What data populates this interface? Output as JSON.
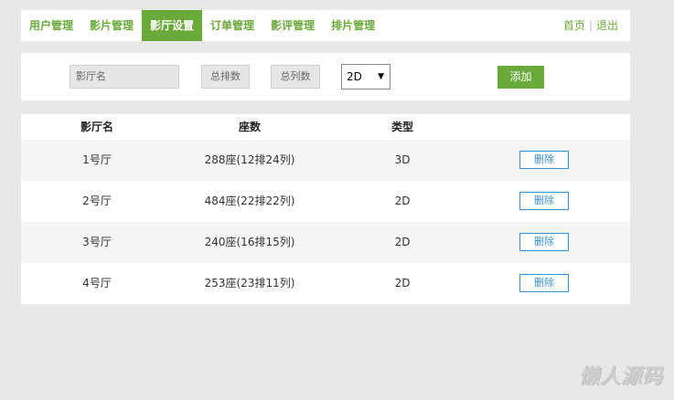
{
  "nav": {
    "tabs": [
      "用户管理",
      "影片管理",
      "影厅设置",
      "订单管理",
      "影评管理",
      "排片管理"
    ],
    "active_index": 2,
    "home": "首页",
    "separator": "|",
    "logout": "退出"
  },
  "form": {
    "name_placeholder": "影厅名",
    "rows_placeholder": "总排数",
    "cols_placeholder": "总列数",
    "type_selected": "2D",
    "add_label": "添加"
  },
  "table": {
    "headers": [
      "影厅名",
      "座数",
      "类型"
    ],
    "rows": [
      {
        "name": "1号厅",
        "seats": "288座(12排24列)",
        "type": "3D",
        "action": "删除"
      },
      {
        "name": "2号厅",
        "seats": "484座(22排22列)",
        "type": "2D",
        "action": "删除"
      },
      {
        "name": "3号厅",
        "seats": "240座(16排15列)",
        "type": "2D",
        "action": "删除"
      },
      {
        "name": "4号厅",
        "seats": "253座(23排11列)",
        "type": "2D",
        "action": "删除"
      }
    ]
  },
  "watermark": "懒人源码",
  "colors": {
    "accent": "#6aaa3a",
    "button_blue": "#3a8fd0",
    "background": "#e8e8e8"
  }
}
